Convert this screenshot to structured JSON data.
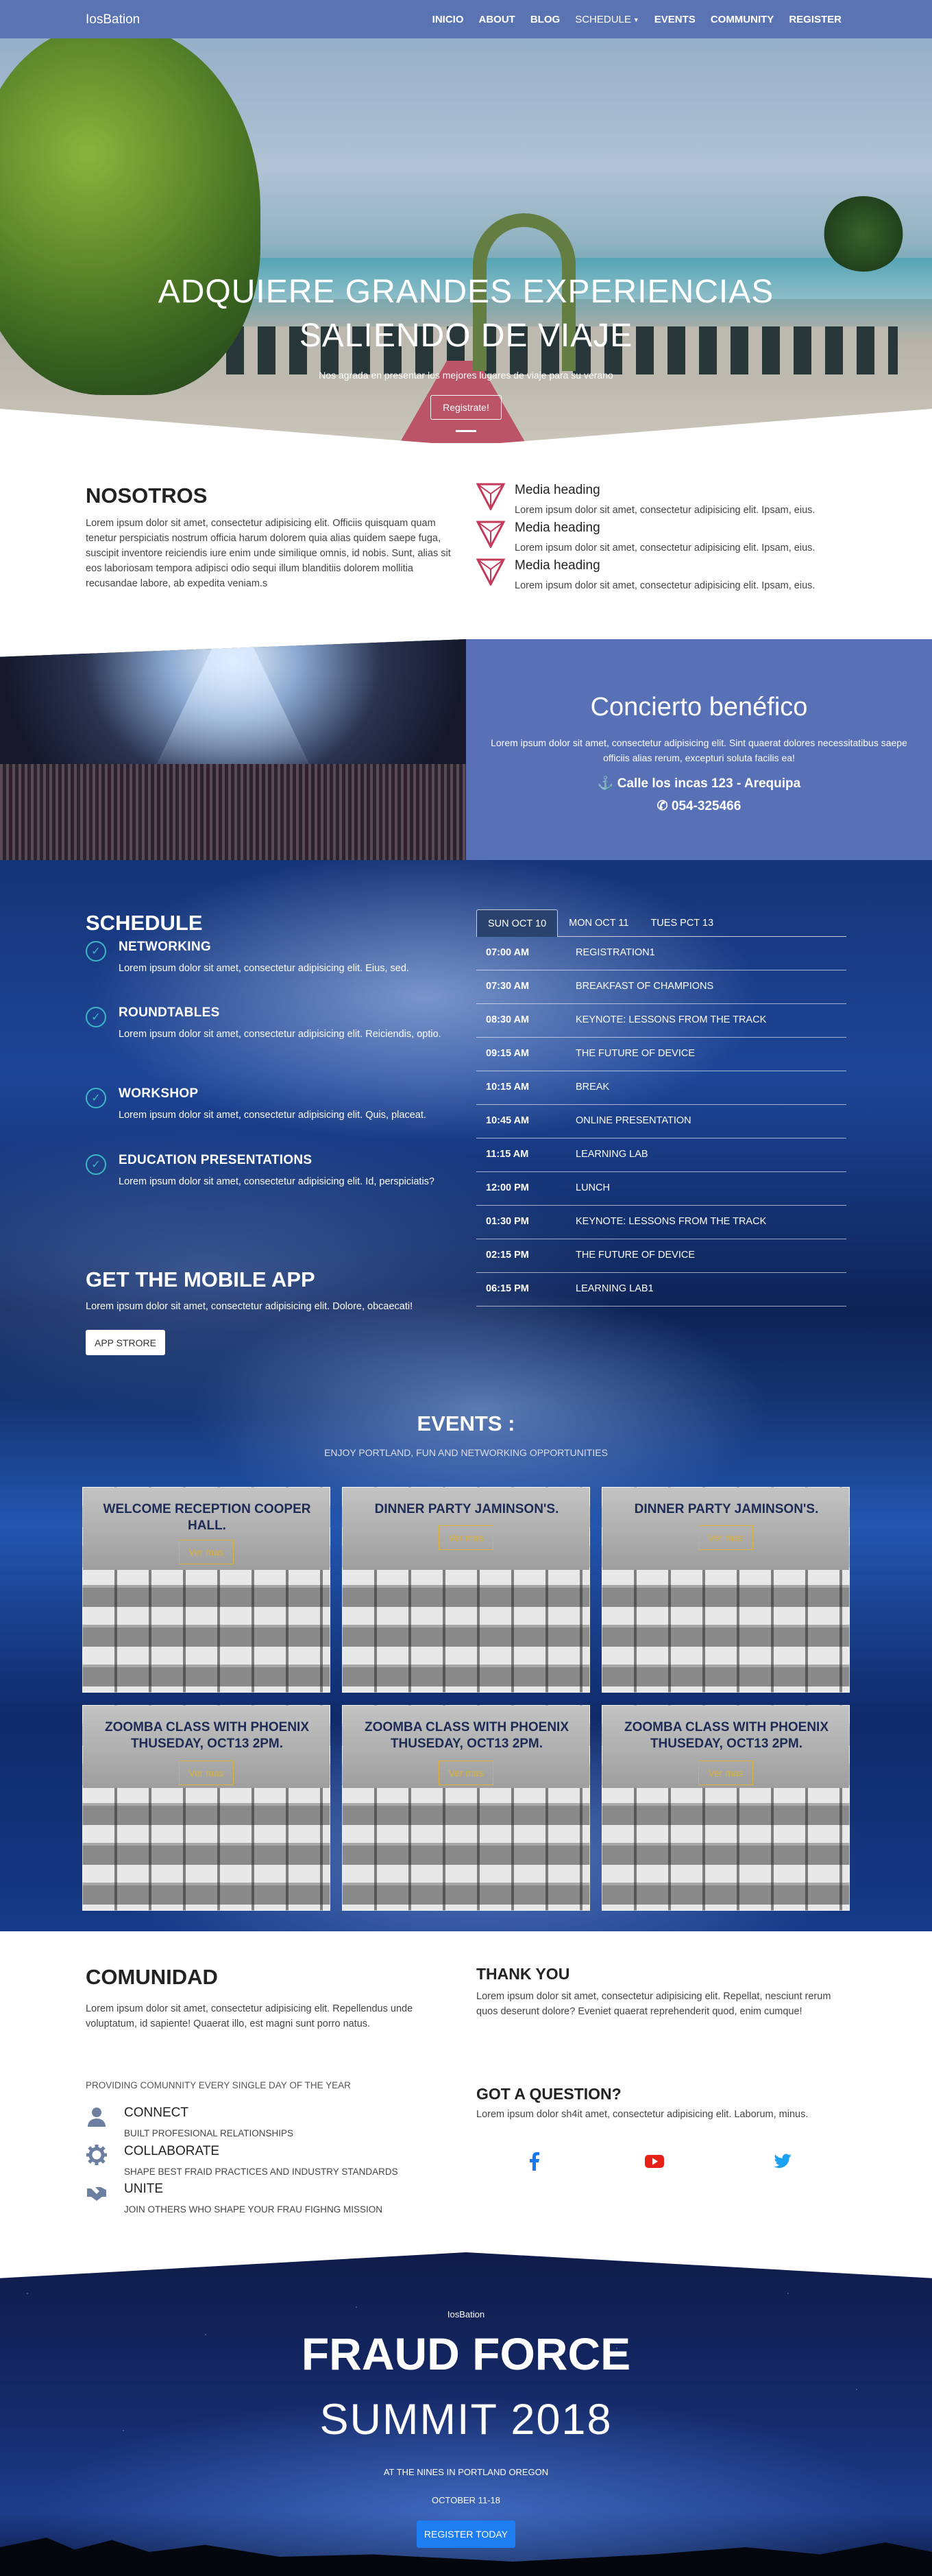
{
  "nav": {
    "brand": "IosBation",
    "items": [
      "INICIO",
      "ABOUT",
      "BLOG",
      "SCHEDULE",
      "EVENTS",
      "COMMUNITY",
      "REGISTER"
    ]
  },
  "hero": {
    "title_line1": "ADQUIERE GRANDES EXPERIENCIAS",
    "title_line2": "SALIENDO DE VIAJE",
    "subtitle": "Nos agrada en presentar los mejores lugares de viaje para su verano",
    "button": "Registrate!"
  },
  "nosotros": {
    "title": "NOSOTROS",
    "text": "Lorem ipsum dolor sit amet, consectetur adipisicing elit. Officiis quisquam quam tenetur perspiciatis nostrum officia harum dolorem quia alias quidem saepe fuga, suscipit inventore reiciendis iure enim unde similique omnis, id nobis. Sunt, alias sit eos laboriosam tempora adipisci odio sequi illum blanditiis dolorem mollitia recusandae labore, ab expedita veniam.s",
    "media": [
      {
        "heading": "Media heading",
        "text": "Lorem ipsum dolor sit amet, consectetur adipisicing elit. Ipsam, eius."
      },
      {
        "heading": "Media heading",
        "text": "Lorem ipsum dolor sit amet, consectetur adipisicing elit. Ipsam, eius."
      },
      {
        "heading": "Media heading",
        "text": "Lorem ipsum dolor sit amet, consectetur adipisicing elit. Ipsam, eius."
      }
    ]
  },
  "concierto": {
    "title": "Concierto benéfico",
    "text": "Lorem ipsum dolor sit amet, consectetur adipisicing elit. Sint quaerat dolores necessitatibus saepe officiis alias rerum, excepturi soluta facilis ea!",
    "address": "Calle los incas 123 - Arequipa",
    "phone": "054-325466"
  },
  "schedule": {
    "title": "SCHEDULE",
    "items": [
      {
        "title": "NETWORKING",
        "text": "Lorem ipsum dolor sit amet, consectetur adipisicing elit. Eius, sed."
      },
      {
        "title": "ROUNDTABLES",
        "text": "Lorem ipsum dolor sit amet, consectetur adipisicing elit. Reiciendis, optio."
      },
      {
        "title": "WORKSHOP",
        "text": "Lorem ipsum dolor sit amet, consectetur adipisicing elit. Quis, placeat."
      },
      {
        "title": "EDUCATION PRESENTATIONS",
        "text": "Lorem ipsum dolor sit amet, consectetur adipisicing elit. Id, perspiciatis?"
      }
    ],
    "tabs": [
      "SUN OCT 10",
      "MON OCT 11",
      "TUES PCT 13"
    ],
    "rows": [
      {
        "time": "07:00 AM",
        "event": "REGISTRATION1"
      },
      {
        "time": "07:30 AM",
        "event": "BREAKFAST OF CHAMPIONS"
      },
      {
        "time": "08:30 AM",
        "event": "KEYNOTE: LESSONS FROM THE TRACK"
      },
      {
        "time": "09:15 AM",
        "event": "THE FUTURE OF DEVICE"
      },
      {
        "time": "10:15 AM",
        "event": "BREAK"
      },
      {
        "time": "10:45 AM",
        "event": "ONLINE PRESENTATION"
      },
      {
        "time": "11:15 AM",
        "event": "LEARNING LAB"
      },
      {
        "time": "12:00 PM",
        "event": "LUNCH"
      },
      {
        "time": "01:30 PM",
        "event": "KEYNOTE: LESSONS FROM THE TRACK"
      },
      {
        "time": "02:15 PM",
        "event": "THE FUTURE OF DEVICE"
      },
      {
        "time": "06:15 PM",
        "event": "LEARNING LAB1"
      }
    ]
  },
  "app": {
    "title": "GET THE MOBILE APP",
    "text": "Lorem ipsum dolor sit amet, consectetur adipisicing elit. Dolore, obcaecati!",
    "button": "APP STRORE"
  },
  "events": {
    "title": "EVENTS :",
    "subtitle": "ENJOY PORTLAND, FUN AND NETWORKING OPPORTUNITIES",
    "button": "Ver mas",
    "cards": [
      {
        "title": "WELCOME RECEPTION COOPER HALL."
      },
      {
        "title": "DINNER PARTY JAMINSON'S."
      },
      {
        "title": "DINNER PARTY JAMINSON'S."
      },
      {
        "title": "ZOOMBA CLASS WITH PHOENIX THUSEDAY, OCT13 2PM."
      },
      {
        "title": "ZOOMBA CLASS WITH PHOENIX THUSEDAY, OCT13 2PM."
      },
      {
        "title": "ZOOMBA CLASS WITH PHOENIX THUSEDAY, OCT13 2PM."
      }
    ]
  },
  "comunidad": {
    "title": "COMUNIDAD",
    "text": "Lorem ipsum dolor sit amet, consectetur adipisicing elit. Repellendus unde voluptatum, id sapiente! Quaerat illo, est magni sunt porro natus.",
    "providing": "PROVIDING COMUNNITY EVERY SINGLE DAY OF THE YEAR",
    "features": [
      {
        "title": "CONNECT",
        "text": "BUILT PROFESIONAL RELATIONSHIPS",
        "icon": "user-icon"
      },
      {
        "title": "COLLABORATE",
        "text": "SHAPE BEST FRAID PRACTICES AND INDUSTRY STANDARDS",
        "icon": "gear-icon"
      },
      {
        "title": "UNITE",
        "text": "JOIN OTHERS WHO SHAPE YOUR FRAU FIGHNG MISSION",
        "icon": "handshake-icon"
      }
    ]
  },
  "thanks": {
    "title": "THANK YOU",
    "text": "Lorem ipsum dolor sit amet, consectetur adipisicing elit. Repellat, nesciunt rerum quos deserunt dolore? Eveniet quaerat reprehenderit quod, enim cumque!"
  },
  "question": {
    "title": "GOT A QUESTION?",
    "text": "Lorem ipsum dolor sh4it amet, consectetur adipisicing elit. Laborum, minus."
  },
  "footer": {
    "brand": "IosBation",
    "title": "FRAUD FORCE",
    "summit": "SUMMIT 2018",
    "location": "AT THE NINES IN PORTLAND OREGON",
    "date": "OCTOBER 11-18",
    "button": "REGISTER TODAY"
  },
  "colors": {
    "nav": "#5a74b3",
    "concert_panel": "#5870b5",
    "accent_teal": "#3fb6c8",
    "triangle_red": "#c43a5a",
    "facebook": "#1877f2",
    "youtube": "#e62117",
    "twitter": "#1da1f2",
    "register": "#1e7df0",
    "card_button": "#d8b135"
  }
}
